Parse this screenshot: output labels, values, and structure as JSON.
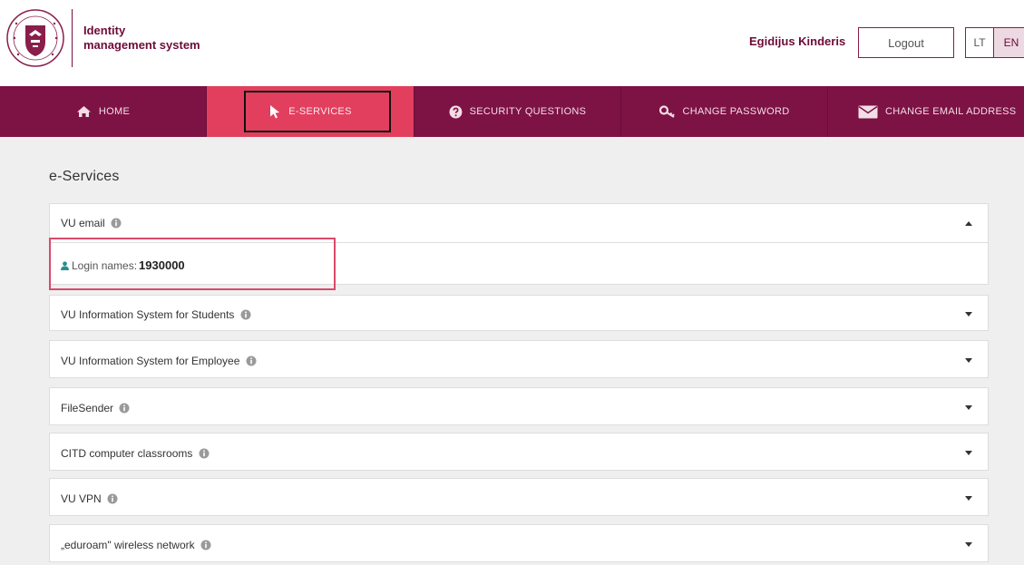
{
  "header": {
    "app_title_line1": "Identity",
    "app_title_line2": "management system",
    "user_name": "Egidijus Kinderis",
    "logout_label": "Logout",
    "lang_lt": "LT",
    "lang_en": "EN"
  },
  "nav": {
    "items": [
      {
        "label": "HOME",
        "icon": "home-icon"
      },
      {
        "label": "E-SERVICES",
        "icon": "cursor-icon",
        "active": true
      },
      {
        "label": "SECURITY QUESTIONS",
        "icon": "question-icon"
      },
      {
        "label": "CHANGE PASSWORD",
        "icon": "key-icon"
      },
      {
        "label": "CHANGE EMAIL ADDRESS",
        "icon": "envelope-icon"
      }
    ]
  },
  "main": {
    "title": "e-Services",
    "panels": [
      {
        "label": "VU email",
        "expanded": true
      },
      {
        "label": "VU Information System for Students",
        "expanded": false
      },
      {
        "label": "VU Information System for Employee",
        "expanded": false
      },
      {
        "label": "FileSender",
        "expanded": false
      },
      {
        "label": "CITD computer classrooms",
        "expanded": false
      },
      {
        "label": "VU VPN",
        "expanded": false
      },
      {
        "label": "„eduroam\" wireless network",
        "expanded": false
      }
    ],
    "email_details": {
      "login_label": "Login names:",
      "login_value": "1930000"
    }
  },
  "colors": {
    "brand": "#7d1244",
    "active": "#e23f5e",
    "background": "#efefef"
  }
}
